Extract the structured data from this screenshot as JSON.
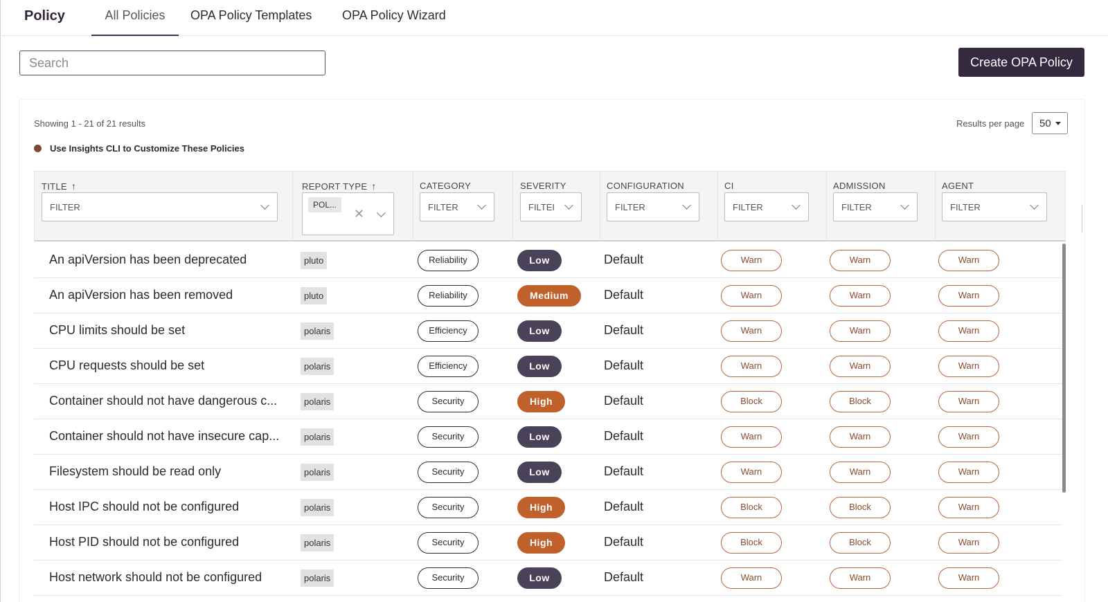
{
  "header": {
    "app_title": "Policy",
    "tabs": [
      {
        "label": "All Policies",
        "active": true
      },
      {
        "label": "OPA Policy Templates",
        "active": false
      },
      {
        "label": "OPA Policy Wizard",
        "active": false
      }
    ]
  },
  "search": {
    "placeholder": "Search",
    "value": ""
  },
  "create_button": "Create OPA Policy",
  "summary": {
    "showing": "Showing 1 - 21 of 21 results",
    "cli_link": "Use Insights CLI to Customize These Policies",
    "results_per_page_label": "Results per page",
    "results_per_page_value": "50"
  },
  "columns": {
    "title": {
      "label": "TITLE",
      "filter": "FILTER"
    },
    "report_type": {
      "label": "REPORT TYPE",
      "filter_chip": "POL..."
    },
    "category": {
      "label": "CATEGORY",
      "filter": "FILTER"
    },
    "severity": {
      "label": "SEVERITY",
      "filter": "FILTEI"
    },
    "configuration": {
      "label": "CONFIGURATION",
      "filter": "FILTER"
    },
    "ci": {
      "label": "CI",
      "filter": "FILTER"
    },
    "admission": {
      "label": "ADMISSION",
      "filter": "FILTER"
    },
    "agent": {
      "label": "AGENT",
      "filter": "FILTER"
    }
  },
  "rows": [
    {
      "title": "An apiVersion has been deprecated",
      "report_type": "pluto",
      "category": "Reliability",
      "severity": "Low",
      "configuration": "Default",
      "ci": "Warn",
      "admission": "Warn",
      "agent": "Warn"
    },
    {
      "title": "An apiVersion has been removed",
      "report_type": "pluto",
      "category": "Reliability",
      "severity": "Medium",
      "configuration": "Default",
      "ci": "Warn",
      "admission": "Warn",
      "agent": "Warn"
    },
    {
      "title": "CPU limits should be set",
      "report_type": "polaris",
      "category": "Efficiency",
      "severity": "Low",
      "configuration": "Default",
      "ci": "Warn",
      "admission": "Warn",
      "agent": "Warn"
    },
    {
      "title": "CPU requests should be set",
      "report_type": "polaris",
      "category": "Efficiency",
      "severity": "Low",
      "configuration": "Default",
      "ci": "Warn",
      "admission": "Warn",
      "agent": "Warn"
    },
    {
      "title": "Container should not have dangerous c...",
      "report_type": "polaris",
      "category": "Security",
      "severity": "High",
      "configuration": "Default",
      "ci": "Block",
      "admission": "Block",
      "agent": "Warn"
    },
    {
      "title": "Container should not have insecure cap...",
      "report_type": "polaris",
      "category": "Security",
      "severity": "Low",
      "configuration": "Default",
      "ci": "Warn",
      "admission": "Warn",
      "agent": "Warn"
    },
    {
      "title": "Filesystem should be read only",
      "report_type": "polaris",
      "category": "Security",
      "severity": "Low",
      "configuration": "Default",
      "ci": "Warn",
      "admission": "Warn",
      "agent": "Warn"
    },
    {
      "title": "Host IPC should not be configured",
      "report_type": "polaris",
      "category": "Security",
      "severity": "High",
      "configuration": "Default",
      "ci": "Block",
      "admission": "Block",
      "agent": "Warn"
    },
    {
      "title": "Host PID should not be configured",
      "report_type": "polaris",
      "category": "Security",
      "severity": "High",
      "configuration": "Default",
      "ci": "Block",
      "admission": "Block",
      "agent": "Warn"
    },
    {
      "title": "Host network should not be configured",
      "report_type": "polaris",
      "category": "Security",
      "severity": "Low",
      "configuration": "Default",
      "ci": "Warn",
      "admission": "Warn",
      "agent": "Warn"
    }
  ],
  "icons": {
    "sort": "arrow-up-icon",
    "dropdown": "chevron-down-icon",
    "clear": "close-icon",
    "dot": "status-dot-icon"
  },
  "colors": {
    "primary": "#34293f",
    "severity_low": "#4a4258",
    "severity_high": "#c0602a",
    "action_border": "#b8643a"
  }
}
